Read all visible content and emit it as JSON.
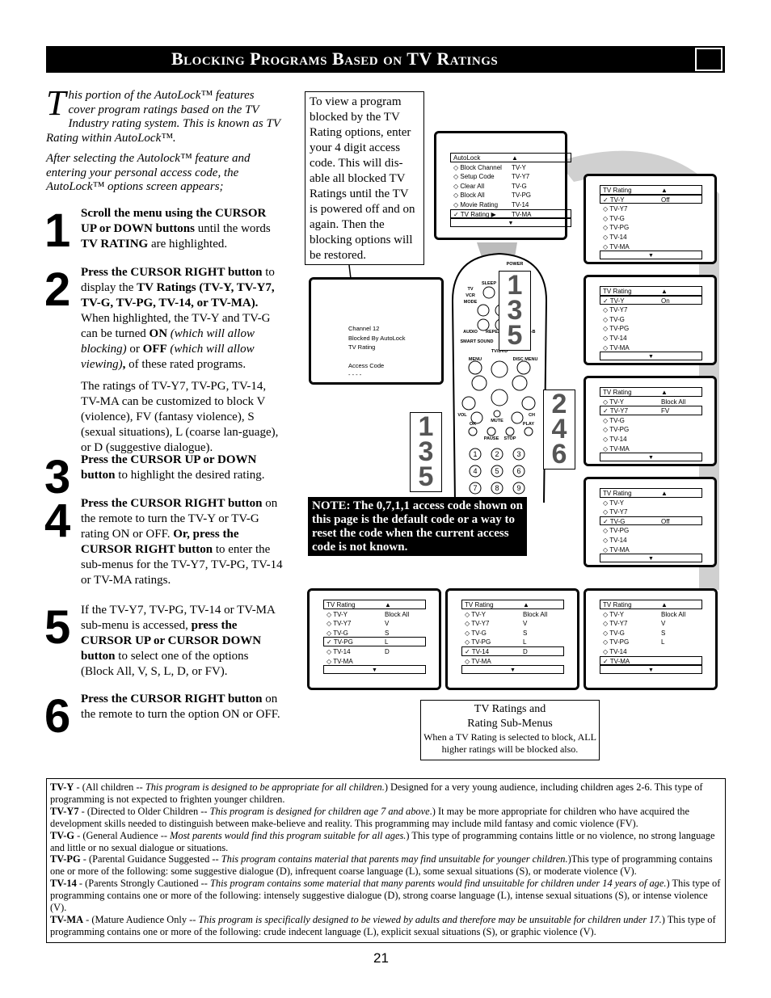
{
  "header": {
    "title": "Blocking Programs Based on TV Ratings",
    "icon": "remote-hand-icon"
  },
  "intro": {
    "dropcap": "T",
    "p1": "his portion of the AutoLock™ features cover program ratings based on the TV Industry rating system. This is known as TV Rating within AutoLock™.",
    "p2": "After selecting the Autolock™ feature and entering your personal access code, the AutoLock™ options screen appears;"
  },
  "steps": [
    {
      "num": "1",
      "html": "<b>Scroll the menu using the CURSOR UP or DOWN buttons</b> until the words <b>TV RATING</b> are highlighted."
    },
    {
      "num": "2",
      "html": "<p><b>Press the CURSOR RIGHT button</b> to display the <b>TV Ratings (TV-Y, TV-Y7, TV-G, TV-PG, TV-14, or TV-MA).</b> When highlighted, the TV-Y and TV-G can be turned <b>ON</b> <i>(which will allow blocking)</i> or <b>OFF</b> <i>(which will allow viewing)</i><b>,</b> of these rated programs.</p><p>The ratings of TV-Y7, TV-PG, TV-14, TV-MA can be customized to block V (violence), FV (fantasy violence), S (sexual situations), L (coarse lan-guage), or D (suggestive dialogue).</p>"
    },
    {
      "num": "3",
      "html": "<b>Press the CURSOR UP or DOWN button</b> to highlight the desired rating."
    },
    {
      "num": "4",
      "html": "<b>Press the CURSOR RIGHT button</b> on the remote to turn the TV-Y or TV-G rating ON or OFF. <b>Or, press the CURSOR RIGHT button</b> to enter the sub-menus for the TV-Y7, TV-PG, TV-14 or TV-MA ratings."
    },
    {
      "num": "5",
      "html": "If the TV-Y7, TV-PG, TV-14 or TV-MA sub-menu is accessed, <b>press the CURSOR UP or CURSOR DOWN button</b> to select one of the options (Block All, V, S, L, D, or FV)."
    },
    {
      "num": "6",
      "html": "<b>Press the CURSOR RIGHT button</b> on the remote to turn the option ON or OFF."
    }
  ],
  "callout": "To view a program blocked by the TV Rating options, enter your 4 digit access code. This will dis-able all blocked TV Ratings until the TV is powered off and on again. Then the blocking options will be restored.",
  "blocked_screen": {
    "l1": "Channel 12",
    "l2": "Blocked By AutoLock",
    "l3": "TV Rating",
    "l4": "Access Code",
    "l5": "- - - -"
  },
  "screens": [
    {
      "title": "AutoLock",
      "rows": [
        [
          "Block Channel",
          "TV-Y",
          0
        ],
        [
          "Setup Code",
          "TV-Y7",
          0
        ],
        [
          "Clear All",
          "TV-G",
          0
        ],
        [
          "Block All",
          "TV-PG",
          0
        ],
        [
          "Movie Rating",
          "TV-14",
          0
        ],
        [
          "TV Rating ▶",
          "TV-MA",
          1
        ]
      ]
    },
    {
      "title": "TV Rating",
      "rows": [
        [
          "TV-Y",
          "Off",
          1
        ],
        [
          "TV-Y7",
          "",
          0
        ],
        [
          "TV-G",
          "",
          0
        ],
        [
          "TV-PG",
          "",
          0
        ],
        [
          "TV-14",
          "",
          0
        ],
        [
          "TV-MA",
          "",
          0
        ]
      ]
    },
    {
      "title": "TV Rating",
      "rows": [
        [
          "TV-Y",
          "On",
          1
        ],
        [
          "TV-Y7",
          "",
          0
        ],
        [
          "TV-G",
          "",
          0
        ],
        [
          "TV-PG",
          "",
          0
        ],
        [
          "TV-14",
          "",
          0
        ],
        [
          "TV-MA",
          "",
          0
        ]
      ]
    },
    {
      "title": "TV Rating",
      "rows": [
        [
          "TV-Y",
          "Block All",
          0
        ],
        [
          "TV-Y7",
          "FV",
          1
        ],
        [
          "TV-G",
          "",
          0
        ],
        [
          "TV-PG",
          "",
          0
        ],
        [
          "TV-14",
          "",
          0
        ],
        [
          "TV-MA",
          "",
          0
        ]
      ]
    },
    {
      "title": "TV Rating",
      "rows": [
        [
          "TV-Y",
          "",
          0
        ],
        [
          "TV-Y7",
          "",
          0
        ],
        [
          "TV-G",
          "Off",
          1
        ],
        [
          "TV-PG",
          "",
          0
        ],
        [
          "TV-14",
          "",
          0
        ],
        [
          "TV-MA",
          "",
          0
        ]
      ]
    },
    {
      "title": "TV Rating",
      "rows": [
        [
          "TV-Y",
          "Block All",
          0
        ],
        [
          "TV-Y7",
          "V",
          0
        ],
        [
          "TV-G",
          "S",
          0
        ],
        [
          "TV-PG",
          "L",
          1
        ],
        [
          "TV-14",
          "D",
          0
        ],
        [
          "TV-MA",
          "",
          0
        ]
      ]
    },
    {
      "title": "TV Rating",
      "rows": [
        [
          "TV-Y",
          "Block All",
          0
        ],
        [
          "TV-Y7",
          "V",
          0
        ],
        [
          "TV-G",
          "S",
          0
        ],
        [
          "TV-PG",
          "L",
          0
        ],
        [
          "TV-14",
          "D",
          1
        ],
        [
          "TV-MA",
          "",
          0
        ]
      ]
    },
    {
      "title": "TV Rating",
      "rows": [
        [
          "TV-Y",
          "Block All",
          0
        ],
        [
          "TV-Y7",
          "V",
          0
        ],
        [
          "TV-G",
          "S",
          0
        ],
        [
          "TV-PG",
          "L",
          0
        ],
        [
          "TV-14",
          "",
          0
        ],
        [
          "TV-MA",
          "",
          1
        ]
      ]
    }
  ],
  "remote": {
    "labels": [
      "POWER",
      "SLEEP",
      "TV",
      "VCR",
      "MODE",
      "AUDIO",
      "REPEAT",
      "REPEAT A-B",
      "SMART SOUND",
      "TV/DVD",
      "MENU",
      "DISC MENU",
      "VOL",
      "CH",
      "MUTE",
      "OK",
      "PAUSE",
      "STOP",
      "PLAY"
    ],
    "digits": [
      "1",
      "2",
      "3",
      "4",
      "5",
      "6",
      "7",
      "8",
      "9"
    ]
  },
  "step_badges": {
    "a": "1 3 5",
    "b": "2 4 6",
    "c": "1 3 5"
  },
  "note": "NOTE: The 0,7,1,1 access code shown on this page is the default code or a way to reset the code when the current access code is not known.",
  "caption": {
    "t1": "TV Ratings and",
    "t2": "Rating Sub-Menus",
    "sub": "When a TV Rating is selected to block, ALL higher ratings will be blocked also."
  },
  "definitions": [
    "<b>TV-Y</b> - (All children -- <i>This program is designed to be appropriate for all children.</i>) Designed for a very young audience, including children ages 2-6. This type of programming is not expected to frighten younger children.",
    "<b>TV-Y7</b> - (Directed to Older Children -- <i>This program is designed for children age 7 and above</i>.) It may be more appropriate for children who have acquired the development skills needed to distinguish between make-believe and reality. This programming may include mild fantasy and comic violence (FV).",
    "<b>TV-G</b> - (General Audience -- <i>Most parents would find this program suitable for all ages.</i>) This type of programming contains little or no violence, no strong language and little or no sexual dialogue or situations.",
    "<b>TV-PG</b> - (Parental Guidance Suggested -- <i>This program contains material that parents may find unsuitable for younger children.</i>)This type of programming contains one or more of the following: some suggestive dialogue (D), infrequent coarse language (L), some sexual situations (S), or moderate violence (V).",
    "<b>TV-14</b> - (Parents Strongly Cautioned -- <i>This program contains some material that many parents would find unsuitable for children under 14 years of age.</i>) This type of programming contains one or more of the following: intensely suggestive dialogue (D), strong coarse language (L), intense sexual situations (S), or intense violence (V).",
    "<b>TV-MA</b> - (Mature Audience Only -- <i>This program is specifically designed to be viewed by adults and therefore may be unsuitable for children under 17.</i>) This type of programming contains one or more of the following: crude indecent language (L), explicit sexual situations (S), or graphic violence (V)."
  ],
  "page_number": "21"
}
